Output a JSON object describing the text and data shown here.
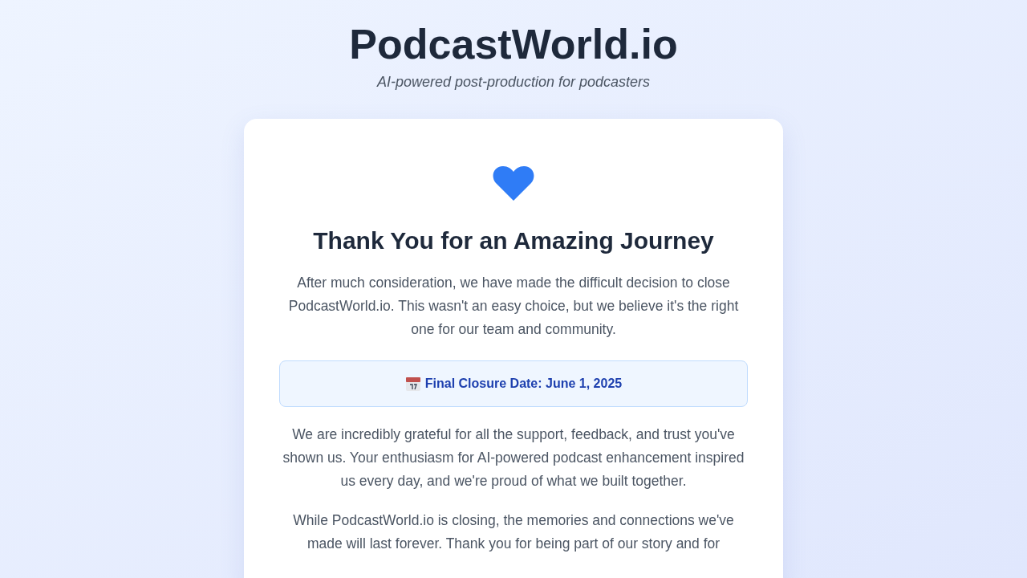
{
  "header": {
    "title": "PodcastWorld.io",
    "tagline": "AI-powered post-production for podcasters"
  },
  "card": {
    "heading": "Thank You for an Amazing Journey",
    "intro": "After much consideration, we have made the difficult decision to close PodcastWorld.io. This wasn't an easy choice, but we believe it's the right one for our team and community.",
    "notice": "Final Closure Date: June 1, 2025",
    "paragraphs": [
      "We are incredibly grateful for all the support, feedback, and trust you've shown us. Your enthusiasm for AI-powered podcast enhancement inspired us every day, and we're proud of what we built together.",
      "While PodcastWorld.io is closing, the memories and connections we've made will last forever. Thank you for being part of our story and for"
    ]
  }
}
